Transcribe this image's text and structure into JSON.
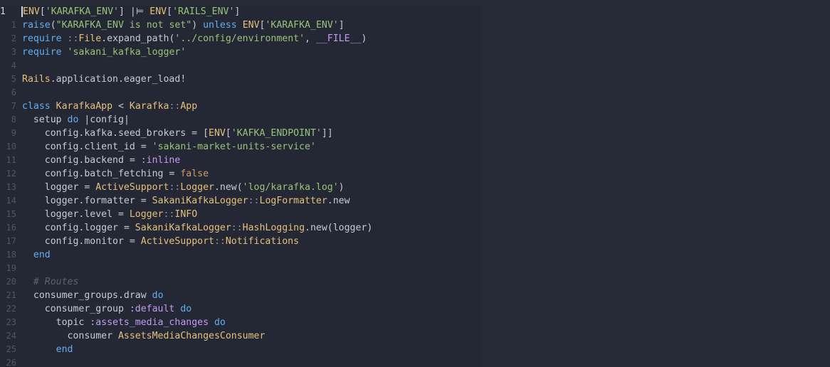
{
  "colors": {
    "background": "#232834",
    "constant": "#e6c07b",
    "keyword": "#61afef",
    "string": "#98c379",
    "symbol": "#c49bef",
    "boolean": "#d19a66",
    "comment": "#5c6370",
    "text": "#c7cbd3",
    "gutter": "#4f5666"
  },
  "editor": {
    "current_line_number": "1",
    "lines": [
      {
        "num": "1",
        "current": true,
        "tokens": [
          {
            "t": "ENV",
            "c": "const"
          },
          {
            "t": "[",
            "c": "plain"
          },
          {
            "t": "'KARAFKA_ENV'",
            "c": "str"
          },
          {
            "t": "] ",
            "c": "plain"
          },
          {
            "t": "|⊨",
            "c": "plain"
          },
          {
            "t": " ",
            "c": "plain"
          },
          {
            "t": "ENV",
            "c": "const"
          },
          {
            "t": "[",
            "c": "plain"
          },
          {
            "t": "'RAILS_ENV'",
            "c": "str"
          },
          {
            "t": "]",
            "c": "plain"
          }
        ]
      },
      {
        "num": "1",
        "current": false,
        "tokens": [
          {
            "t": "raise",
            "c": "kw"
          },
          {
            "t": "(",
            "c": "plain"
          },
          {
            "t": "\"KARAFKA_ENV is not set\"",
            "c": "str"
          },
          {
            "t": ") ",
            "c": "plain"
          },
          {
            "t": "unless",
            "c": "kw"
          },
          {
            "t": " ",
            "c": "plain"
          },
          {
            "t": "ENV",
            "c": "const"
          },
          {
            "t": "[",
            "c": "plain"
          },
          {
            "t": "'KARAFKA_ENV'",
            "c": "str"
          },
          {
            "t": "]",
            "c": "plain"
          }
        ]
      },
      {
        "num": "2",
        "current": false,
        "tokens": [
          {
            "t": "require",
            "c": "kw"
          },
          {
            "t": " ",
            "c": "plain"
          },
          {
            "t": "::",
            "c": "dim"
          },
          {
            "t": "File",
            "c": "const"
          },
          {
            "t": ".expand_path(",
            "c": "plain"
          },
          {
            "t": "'../config/environment'",
            "c": "str"
          },
          {
            "t": ", ",
            "c": "plain"
          },
          {
            "t": "__FILE__",
            "c": "sym"
          },
          {
            "t": ")",
            "c": "plain"
          }
        ]
      },
      {
        "num": "3",
        "current": false,
        "tokens": [
          {
            "t": "require",
            "c": "kw"
          },
          {
            "t": " ",
            "c": "plain"
          },
          {
            "t": "'sakani_kafka_logger'",
            "c": "str"
          }
        ]
      },
      {
        "num": "4",
        "current": false,
        "tokens": []
      },
      {
        "num": "5",
        "current": false,
        "tokens": [
          {
            "t": "Rails",
            "c": "const"
          },
          {
            "t": ".application.eager_load!",
            "c": "plain"
          }
        ]
      },
      {
        "num": "6",
        "current": false,
        "tokens": []
      },
      {
        "num": "7",
        "current": false,
        "tokens": [
          {
            "t": "class",
            "c": "kw"
          },
          {
            "t": " ",
            "c": "plain"
          },
          {
            "t": "KarafkaApp",
            "c": "const"
          },
          {
            "t": " < ",
            "c": "plain"
          },
          {
            "t": "Karafka",
            "c": "const"
          },
          {
            "t": "::",
            "c": "dim"
          },
          {
            "t": "App",
            "c": "const"
          }
        ]
      },
      {
        "num": "8",
        "current": false,
        "tokens": [
          {
            "t": "  setup ",
            "c": "plain"
          },
          {
            "t": "do",
            "c": "kw"
          },
          {
            "t": " |config|",
            "c": "plain"
          }
        ]
      },
      {
        "num": "9",
        "current": false,
        "tokens": [
          {
            "t": "    config.kafka.seed_brokers = [",
            "c": "plain"
          },
          {
            "t": "ENV",
            "c": "const"
          },
          {
            "t": "[",
            "c": "plain"
          },
          {
            "t": "'KAFKA_ENDPOINT'",
            "c": "str"
          },
          {
            "t": "]]",
            "c": "plain"
          }
        ]
      },
      {
        "num": "10",
        "current": false,
        "tokens": [
          {
            "t": "    config.client_id = ",
            "c": "plain"
          },
          {
            "t": "'sakani-market-units-service'",
            "c": "str"
          }
        ]
      },
      {
        "num": "11",
        "current": false,
        "tokens": [
          {
            "t": "    config.backend = ",
            "c": "plain"
          },
          {
            "t": ":inline",
            "c": "sym"
          }
        ]
      },
      {
        "num": "12",
        "current": false,
        "tokens": [
          {
            "t": "    config.batch_fetching = ",
            "c": "plain"
          },
          {
            "t": "false",
            "c": "bool"
          }
        ]
      },
      {
        "num": "13",
        "current": false,
        "tokens": [
          {
            "t": "    logger = ",
            "c": "plain"
          },
          {
            "t": "ActiveSupport",
            "c": "const"
          },
          {
            "t": "::",
            "c": "dim"
          },
          {
            "t": "Logger",
            "c": "const"
          },
          {
            "t": ".new(",
            "c": "plain"
          },
          {
            "t": "'log/karafka.log'",
            "c": "str"
          },
          {
            "t": ")",
            "c": "plain"
          }
        ]
      },
      {
        "num": "14",
        "current": false,
        "tokens": [
          {
            "t": "    logger.formatter = ",
            "c": "plain"
          },
          {
            "t": "SakaniKafkaLogger",
            "c": "const"
          },
          {
            "t": "::",
            "c": "dim"
          },
          {
            "t": "LogFormatter",
            "c": "const"
          },
          {
            "t": ".new",
            "c": "plain"
          }
        ]
      },
      {
        "num": "15",
        "current": false,
        "tokens": [
          {
            "t": "    logger.level = ",
            "c": "plain"
          },
          {
            "t": "Logger",
            "c": "const"
          },
          {
            "t": "::",
            "c": "dim"
          },
          {
            "t": "INFO",
            "c": "const"
          }
        ]
      },
      {
        "num": "16",
        "current": false,
        "tokens": [
          {
            "t": "    config.logger = ",
            "c": "plain"
          },
          {
            "t": "SakaniKafkaLogger",
            "c": "const"
          },
          {
            "t": "::",
            "c": "dim"
          },
          {
            "t": "HashLogging",
            "c": "const"
          },
          {
            "t": ".new(logger)",
            "c": "plain"
          }
        ]
      },
      {
        "num": "17",
        "current": false,
        "tokens": [
          {
            "t": "    config.monitor = ",
            "c": "plain"
          },
          {
            "t": "ActiveSupport",
            "c": "const"
          },
          {
            "t": "::",
            "c": "dim"
          },
          {
            "t": "Notifications",
            "c": "const"
          }
        ]
      },
      {
        "num": "18",
        "current": false,
        "tokens": [
          {
            "t": "  ",
            "c": "plain"
          },
          {
            "t": "end",
            "c": "kw"
          }
        ]
      },
      {
        "num": "19",
        "current": false,
        "tokens": []
      },
      {
        "num": "20",
        "current": false,
        "tokens": [
          {
            "t": "  ",
            "c": "plain"
          },
          {
            "t": "# Routes",
            "c": "comment"
          }
        ]
      },
      {
        "num": "21",
        "current": false,
        "tokens": [
          {
            "t": "  consumer_groups.draw ",
            "c": "plain"
          },
          {
            "t": "do",
            "c": "kw"
          }
        ]
      },
      {
        "num": "22",
        "current": false,
        "tokens": [
          {
            "t": "    consumer_group ",
            "c": "plain"
          },
          {
            "t": ":default",
            "c": "sym"
          },
          {
            "t": " ",
            "c": "plain"
          },
          {
            "t": "do",
            "c": "kw"
          }
        ]
      },
      {
        "num": "23",
        "current": false,
        "tokens": [
          {
            "t": "      topic ",
            "c": "plain"
          },
          {
            "t": ":assets_media_changes",
            "c": "sym"
          },
          {
            "t": " ",
            "c": "plain"
          },
          {
            "t": "do",
            "c": "kw"
          }
        ]
      },
      {
        "num": "24",
        "current": false,
        "tokens": [
          {
            "t": "        consumer ",
            "c": "plain"
          },
          {
            "t": "AssetsMediaChangesConsumer",
            "c": "const"
          }
        ]
      },
      {
        "num": "25",
        "current": false,
        "tokens": [
          {
            "t": "      ",
            "c": "plain"
          },
          {
            "t": "end",
            "c": "kw"
          }
        ]
      },
      {
        "num": "26",
        "current": false,
        "tokens": []
      }
    ]
  }
}
